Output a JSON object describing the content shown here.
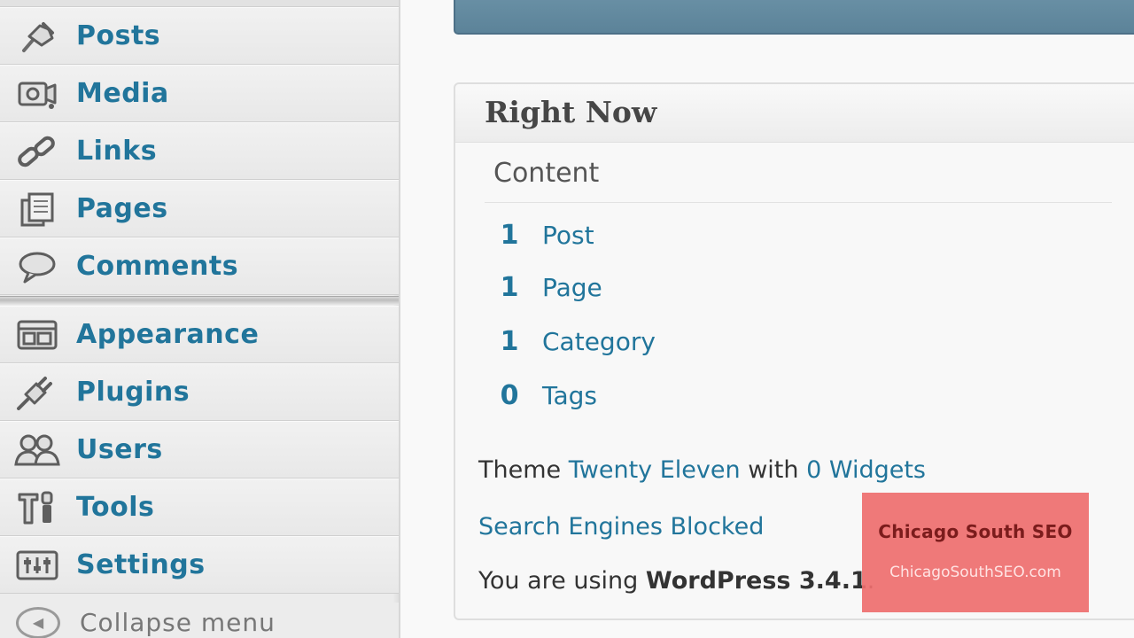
{
  "sidebar": {
    "items": [
      {
        "label": "Posts",
        "icon": "pin-icon"
      },
      {
        "label": "Media",
        "icon": "media-icon"
      },
      {
        "label": "Links",
        "icon": "link-icon"
      },
      {
        "label": "Pages",
        "icon": "pages-icon"
      },
      {
        "label": "Comments",
        "icon": "comment-icon"
      },
      {
        "label": "Appearance",
        "icon": "appearance-icon"
      },
      {
        "label": "Plugins",
        "icon": "plug-icon"
      },
      {
        "label": "Users",
        "icon": "users-icon"
      },
      {
        "label": "Tools",
        "icon": "tools-icon"
      },
      {
        "label": "Settings",
        "icon": "settings-icon"
      }
    ],
    "collapse_label": "Collapse menu"
  },
  "right_now": {
    "title": "Right Now",
    "content_heading": "Content",
    "counts": [
      {
        "num": "1",
        "label": "Post"
      },
      {
        "num": "1",
        "label": "Page"
      },
      {
        "num": "1",
        "label": "Category"
      },
      {
        "num": "0",
        "label": "Tags"
      }
    ],
    "theme_prefix": "Theme",
    "theme_name": "Twenty Eleven",
    "theme_with": "with",
    "widgets_link": "0 Widgets",
    "search_engines": "Search Engines Blocked",
    "using_prefix": "You are using",
    "wp_version": "WordPress 3.4.1",
    "using_suffix": "."
  },
  "watermark": {
    "name": "Chicago South SEO",
    "url": "ChicagoSouthSEO.com"
  },
  "colors": {
    "link": "#21759b",
    "top_bar": "#628a9f",
    "watermark": "#ee6e6e"
  }
}
